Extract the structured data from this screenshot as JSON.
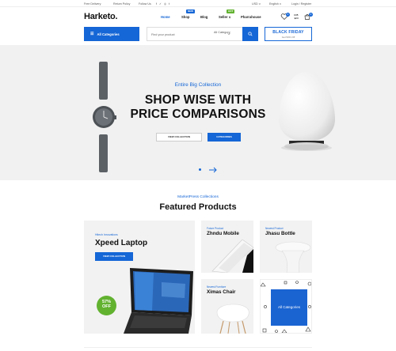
{
  "topbar": {
    "free_delivery": "Free Delivery",
    "return_policy": "Return Policy",
    "follow_us": "Follow Us",
    "social_icons": "f ✓ ◎ t",
    "currency": "USD ∨",
    "language": "English ∨",
    "account": "Login / Register"
  },
  "header": {
    "logo": "Harketo.",
    "nav": [
      {
        "label": "Home",
        "active": true
      },
      {
        "label": "Shop",
        "badge": "NEW",
        "badge_color": "#1566d6"
      },
      {
        "label": "Blog"
      },
      {
        "label": "Seller ∨",
        "badge": "HOT",
        "badge_color": "#62b230"
      },
      {
        "label": "Pharrahouse"
      }
    ],
    "wishlist_count": "0",
    "cart_count": "0"
  },
  "search": {
    "categories_label": "All Categories",
    "placeholder": "Find your product",
    "select_value": "All Category",
    "promo_title": "BLACK FRIDAY",
    "promo_sub": "Get 50% Off"
  },
  "hero": {
    "subtitle": "Entire Big Collection",
    "title_line1": "SHOP WISE WITH",
    "title_line2": "PRICE COMPARISONS",
    "btn_collection": "VIEW COLLECTION",
    "btn_categories": "CATEGORIES"
  },
  "featured": {
    "subtitle": "MarketPress Collections",
    "title": "Featured Products",
    "laptop": {
      "category": "Hitech Innovations",
      "name": "Xpeed Laptop",
      "button": "VIEW COLLECTION",
      "discount_value": "57%",
      "discount_label": "OFF"
    },
    "mobile": {
      "category": "Future Product",
      "name": "Zhndu Mobile"
    },
    "bottle": {
      "category": "Newest Product",
      "name": "Jhasu Bottle"
    },
    "chair": {
      "category": "Newest Furniture",
      "name": "Ximas Chair"
    },
    "all_categories": "All Categories"
  },
  "colors": {
    "accent": "#1566d6",
    "green": "#62b230",
    "hero_bg": "#f1f1f1"
  }
}
